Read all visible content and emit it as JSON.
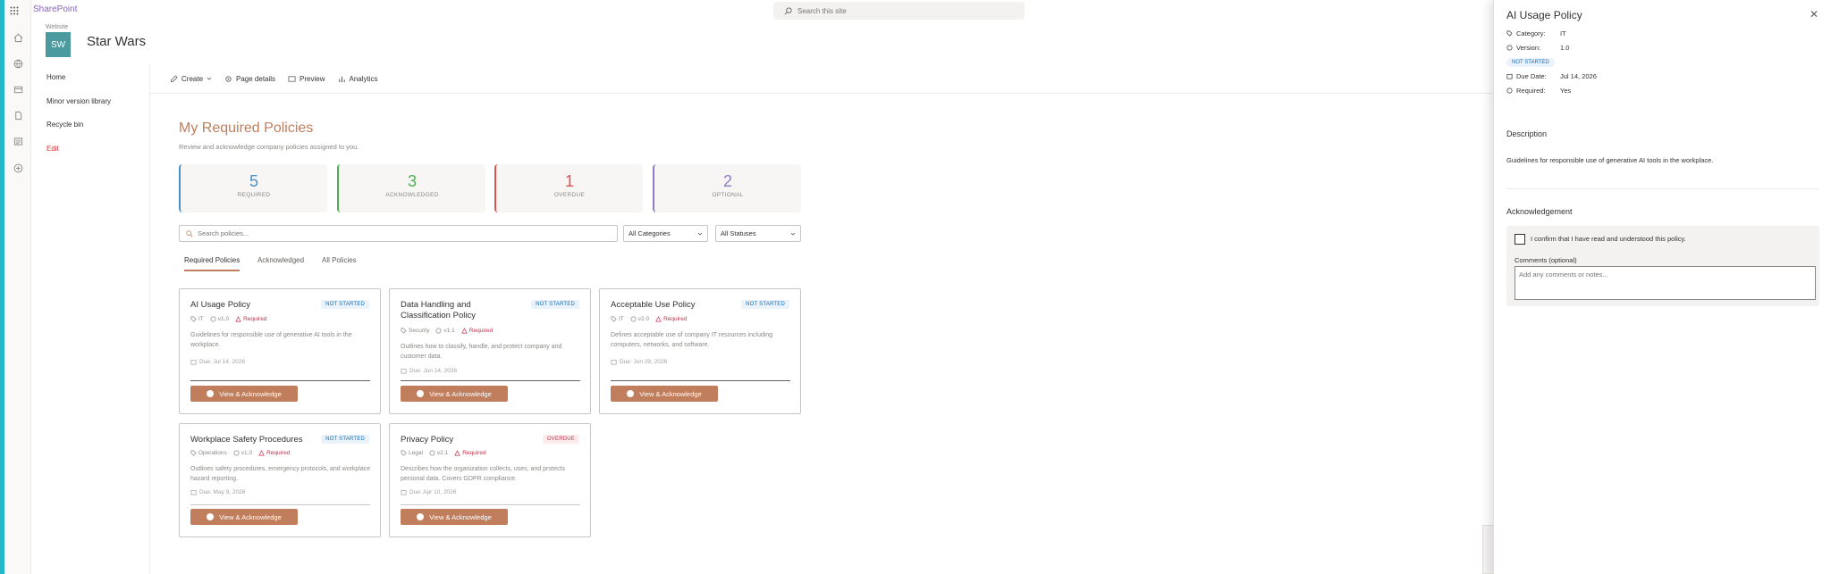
{
  "app": {
    "name": "SharePoint",
    "search_placeholder": "Search this site"
  },
  "site": {
    "tiny_label": "Website",
    "logo": "SW",
    "title": "Star Wars"
  },
  "nav": {
    "items": [
      "Home",
      "Minor version library",
      "Recycle bin"
    ],
    "edit": "Edit"
  },
  "commands": {
    "create": "Create",
    "page_details": "Page details",
    "preview": "Preview",
    "analytics": "Analytics"
  },
  "page": {
    "title": "My Required Policies",
    "subtitle": "Review and acknowledge company policies assigned to you."
  },
  "stats": [
    {
      "value": "5",
      "label": "REQUIRED",
      "color": "#4a90c9"
    },
    {
      "value": "3",
      "label": "ACKNOWLEDGED",
      "color": "#4caf50"
    },
    {
      "value": "1",
      "label": "OVERDUE",
      "color": "#d9534f"
    },
    {
      "value": "2",
      "label": "OPTIONAL",
      "color": "#8e7cc3"
    }
  ],
  "filters": {
    "search_placeholder": "Search policies...",
    "category": "All Categories",
    "status": "All Statuses"
  },
  "tabs": [
    "Required Policies",
    "Acknowledged",
    "All Policies"
  ],
  "cards": [
    {
      "title": "AI Usage Policy",
      "status": "NOT STARTED",
      "category": "IT",
      "version": "v1.0",
      "required": "Required",
      "desc": "Guidelines for responsible use of generative AI tools in the workplace.",
      "due": "Due: Jul 14, 2026",
      "button": "View & Acknowledge"
    },
    {
      "title": "Data Handling and Classification Policy",
      "status": "NOT STARTED",
      "category": "Security",
      "version": "v1.1",
      "required": "Required",
      "desc": "Outlines how to classify, handle, and protect company and customer data.",
      "due": "Due: Jun 14, 2026",
      "button": "View & Acknowledge"
    },
    {
      "title": "Acceptable Use Policy",
      "status": "NOT STARTED",
      "category": "IT",
      "version": "v2.0",
      "required": "Required",
      "desc": "Defines acceptable use of company IT resources including computers, networks, and software.",
      "due": "Due: Jun 29, 2026",
      "button": "View & Acknowledge"
    },
    {
      "title": "Workplace Safety Procedures",
      "status": "NOT STARTED",
      "category": "Operations",
      "version": "v1.0",
      "required": "Required",
      "desc": "Outlines safety procedures, emergency protocols, and workplace hazard reporting.",
      "due": "Due: May 9, 2026",
      "button": "View & Acknowledge"
    },
    {
      "title": "Privacy Policy",
      "status": "OVERDUE",
      "category": "Legal",
      "version": "v2.1",
      "required": "Required",
      "desc": "Describes how the organization collects, uses, and protects personal data. Covers GDPR compliance.",
      "due": "Due: Apr 10, 2026",
      "button": "View & Acknowledge"
    }
  ],
  "panel": {
    "title": "AI Usage Policy",
    "category_label": "Category:",
    "category": "IT",
    "version_label": "Version:",
    "version": "1.0",
    "status": "NOT STARTED",
    "due_label": "Due Date:",
    "due": "Jul 14, 2026",
    "required_label": "Required:",
    "required": "Yes",
    "description_title": "Description",
    "description": "Guidelines for responsible use of generative AI tools in the workplace.",
    "ack_title": "Acknowledgement",
    "confirm_label": "I confirm that I have read and understood this policy.",
    "comments_label": "Comments (optional)",
    "comments_placeholder": "Add any comments or notes..."
  }
}
